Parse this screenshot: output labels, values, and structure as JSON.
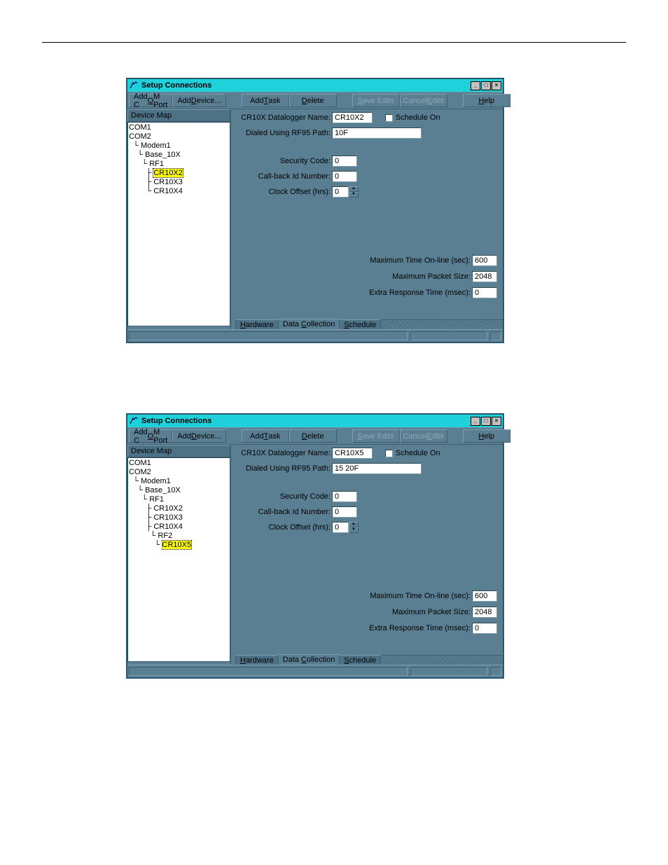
{
  "window": {
    "title": "Setup Connections",
    "toolbar": {
      "add_com_port": "Add COM Port",
      "add_device": "Add Device...",
      "add_task": "Add Task",
      "delete": "Delete",
      "save_edits": "Save Edits",
      "cancel_edits": "Cancel Edits",
      "help": "Help"
    },
    "side_header": "Device Map",
    "tabs": {
      "hardware": "Hardware",
      "data_collection": "Data Collection",
      "schedule": "Schedule"
    },
    "labels": {
      "datalogger_name": "CR10X Datalogger Name:",
      "schedule_on": "Schedule On",
      "dialed_using": "Dialed Using RF95  Path:",
      "security_code": "Security Code:",
      "callback_id": "Call-back Id Number:",
      "clock_offset": "Clock Offset (hrs):",
      "max_online": "Maximum Time On-line (sec):",
      "max_packet": "Maximum Packet Size:",
      "extra_response": "Extra Response Time (msec):"
    }
  },
  "screens": [
    {
      "tree": [
        {
          "indent": 0,
          "prefix": "",
          "label": "COM1"
        },
        {
          "indent": 0,
          "prefix": "",
          "label": "COM2"
        },
        {
          "indent": 1,
          "prefix": "└ ",
          "label": "Modem1"
        },
        {
          "indent": 2,
          "prefix": "└ ",
          "label": "Base_10X"
        },
        {
          "indent": 3,
          "prefix": "└ ",
          "label": "RF1"
        },
        {
          "indent": 4,
          "prefix": "├ ",
          "label": "CR10X2",
          "selected": true
        },
        {
          "indent": 4,
          "prefix": "├ ",
          "label": "CR10X3"
        },
        {
          "indent": 4,
          "prefix": "└ ",
          "label": "CR10X4"
        }
      ],
      "values": {
        "name": "CR10X2",
        "path": "10F",
        "security": "0",
        "callback": "0",
        "clock_offset": "0",
        "max_online": "600",
        "max_packet": "2048",
        "extra_response": "0"
      }
    },
    {
      "tree": [
        {
          "indent": 0,
          "prefix": "",
          "label": "COM1"
        },
        {
          "indent": 0,
          "prefix": "",
          "label": "COM2"
        },
        {
          "indent": 1,
          "prefix": "└ ",
          "label": "Modem1"
        },
        {
          "indent": 2,
          "prefix": "└ ",
          "label": "Base_10X"
        },
        {
          "indent": 3,
          "prefix": "└ ",
          "label": "RF1"
        },
        {
          "indent": 4,
          "prefix": "├ ",
          "label": "CR10X2"
        },
        {
          "indent": 4,
          "prefix": "├ ",
          "label": "CR10X3"
        },
        {
          "indent": 4,
          "prefix": "├ ",
          "label": "CR10X4"
        },
        {
          "indent": 5,
          "prefix": "└ ",
          "label": "RF2"
        },
        {
          "indent": 6,
          "prefix": "└ ",
          "label": "CR10X5",
          "selected": true
        }
      ],
      "values": {
        "name": "CR10X5",
        "path": "15 20F",
        "security": "0",
        "callback": "0",
        "clock_offset": "0",
        "max_online": "600",
        "max_packet": "2048",
        "extra_response": "0"
      }
    }
  ]
}
